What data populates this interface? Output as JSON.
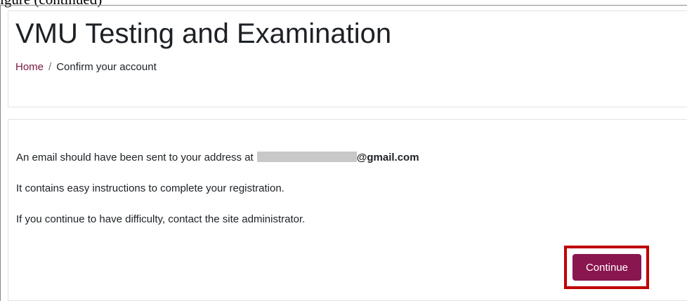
{
  "cutoff_caption": "igure (continued)",
  "header": {
    "title": "VMU Testing and Examination",
    "breadcrumb": {
      "home_label": "Home",
      "separator": "/",
      "current_label": "Confirm your account"
    }
  },
  "main": {
    "message_prefix": "An email should have been sent to your address at",
    "email_domain": "@gmail.com",
    "instructions_text": "It contains easy instructions to complete your registration.",
    "difficulty_text": "If you continue to have difficulty, contact the site administrator.",
    "continue_label": "Continue"
  },
  "colors": {
    "primary": "#8a1650",
    "link": "#7a1743",
    "highlight_border": "#c00000",
    "redaction": "#c8c8c8"
  }
}
